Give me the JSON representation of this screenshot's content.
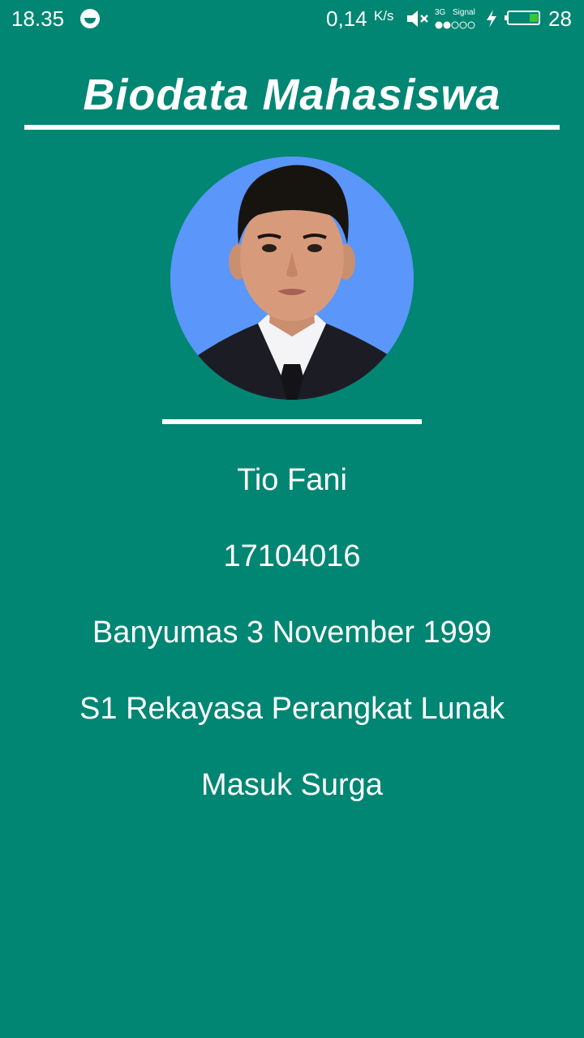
{
  "status_bar": {
    "time": "18.35",
    "network_speed": "0,14",
    "network_speed_unit": "K/s",
    "network_type": "3G",
    "signal_label": "Signal",
    "battery_level": "28",
    "battery_fraction": 0.28,
    "battery_color": "#39c43a"
  },
  "header": {
    "title": "Biodata Mahasiswa"
  },
  "profile": {
    "photo_icon": "profile-photo",
    "photo_background": "#5b96fb",
    "name": "Tio Fani",
    "student_id": "17104016",
    "birth_place_date": "Banyumas 3 November 1999",
    "study_program": "S1 Rekayasa Perangkat Lunak",
    "aspiration": "Masuk Surga"
  },
  "theme": {
    "background": "#008673",
    "text": "#ffffff"
  }
}
